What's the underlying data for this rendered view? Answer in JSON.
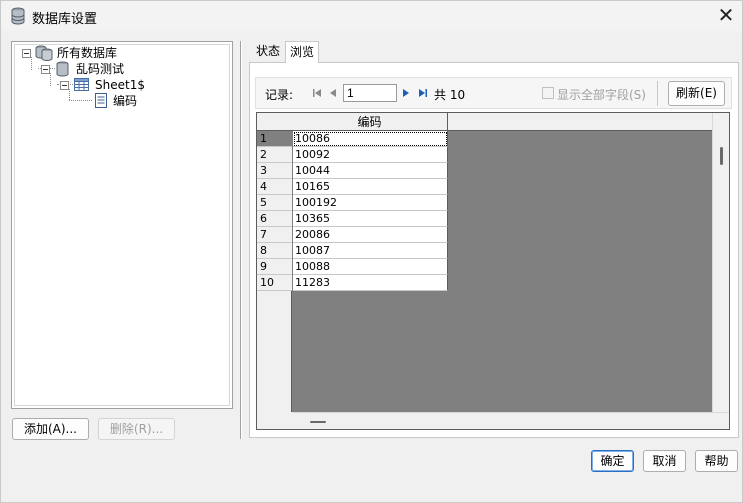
{
  "window": {
    "title": "数据库设置",
    "close_glyph": "✕"
  },
  "tree": {
    "root": "所有数据库",
    "database": "乱码测试",
    "table": "Sheet1$",
    "field": "编码"
  },
  "left_buttons": {
    "add": "添加(A)...",
    "delete": "删除(R)..."
  },
  "tabs": [
    {
      "label": "状态"
    },
    {
      "label": "浏览"
    }
  ],
  "toolbar": {
    "record_label": "记录:",
    "current_record": "1",
    "total_label": "共 10",
    "show_all_fields": "显示全部字段(S)",
    "refresh": "刷新(E)"
  },
  "grid": {
    "column": "编码",
    "rows": [
      {
        "num": "1",
        "value": "10086"
      },
      {
        "num": "2",
        "value": "10092"
      },
      {
        "num": "3",
        "value": "10044"
      },
      {
        "num": "4",
        "value": "10165"
      },
      {
        "num": "5",
        "value": "100192"
      },
      {
        "num": "6",
        "value": "10365"
      },
      {
        "num": "7",
        "value": "20086"
      },
      {
        "num": "8",
        "value": "10087"
      },
      {
        "num": "9",
        "value": "10088"
      },
      {
        "num": "10",
        "value": "11283"
      }
    ]
  },
  "footer_buttons": {
    "ok": "确定",
    "cancel": "取消",
    "help": "帮助"
  },
  "colors": {
    "grid_background": "#808080",
    "accent_blue": "#2b6fc4"
  }
}
